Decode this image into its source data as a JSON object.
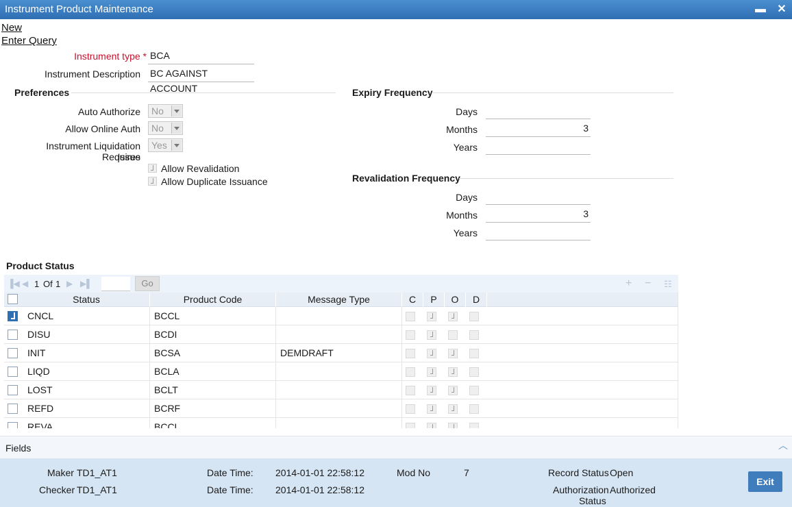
{
  "window": {
    "title": "Instrument Product Maintenance",
    "minimize": "▬",
    "close": "✕"
  },
  "links": {
    "new": "New",
    "enter_query": "Enter Query"
  },
  "instrument": {
    "type_label": "Instrument type",
    "required_mark": "*",
    "type_value": "BCA",
    "description_label": "Instrument Description",
    "description_value": "BC AGAINST ACCOUNT"
  },
  "preferences": {
    "title": "Preferences",
    "auto_authorize_label": "Auto Authorize",
    "auto_authorize_value": "No",
    "allow_online_auth_label": "Allow Online Auth",
    "allow_online_auth_value": "No",
    "liquidation_label_1": "Instrument Liquidation Requires",
    "liquidation_label_2": "Issue",
    "liquidation_value": "Yes",
    "allow_revalidation_label": "Allow Revalidation",
    "allow_duplicate_label": "Allow Duplicate Issuance"
  },
  "expiry": {
    "title": "Expiry Frequency",
    "days_label": "Days",
    "days_value": "",
    "months_label": "Months",
    "months_value": "3",
    "years_label": "Years",
    "years_value": ""
  },
  "revalidation": {
    "title": "Revalidation Frequency",
    "days_label": "Days",
    "days_value": "",
    "months_label": "Months",
    "months_value": "3",
    "years_label": "Years",
    "years_value": ""
  },
  "product_status": {
    "title": "Product Status",
    "pager": {
      "current": "1",
      "of_label": "Of",
      "total": "1",
      "go_label": "Go"
    },
    "columns": {
      "status": "Status",
      "product_code": "Product Code",
      "message_type": "Message Type",
      "c": "C",
      "p": "P",
      "o": "O",
      "d": "D"
    },
    "rows": [
      {
        "status": "CNCL",
        "product_code": "BCCL",
        "message_type": ""
      },
      {
        "status": "DISU",
        "product_code": "BCDI",
        "message_type": ""
      },
      {
        "status": "INIT",
        "product_code": "BCSA",
        "message_type": "DEMDRAFT"
      },
      {
        "status": "LIQD",
        "product_code": "BCLA",
        "message_type": ""
      },
      {
        "status": "LOST",
        "product_code": "BCLT",
        "message_type": ""
      },
      {
        "status": "REFD",
        "product_code": "BCRF",
        "message_type": ""
      },
      {
        "status": "REVA",
        "product_code": "BCCL",
        "message_type": ""
      }
    ]
  },
  "fields_bar": {
    "label": "Fields"
  },
  "footer": {
    "maker_label": "Maker",
    "maker_value": "TD1_AT1",
    "checker_label": "Checker",
    "checker_value": "TD1_AT1",
    "datetime_label": "Date Time:",
    "maker_datetime": "2014-01-01 22:58:12",
    "checker_datetime": "2014-01-01 22:58:12",
    "mod_no_label": "Mod No",
    "mod_no_value": "7",
    "record_status_label": "Record Status",
    "record_status_value": "Open",
    "auth_status_label_1": "Authorization",
    "auth_status_label_2": "Status",
    "auth_status_value": "Authorized",
    "exit_label": "Exit"
  }
}
